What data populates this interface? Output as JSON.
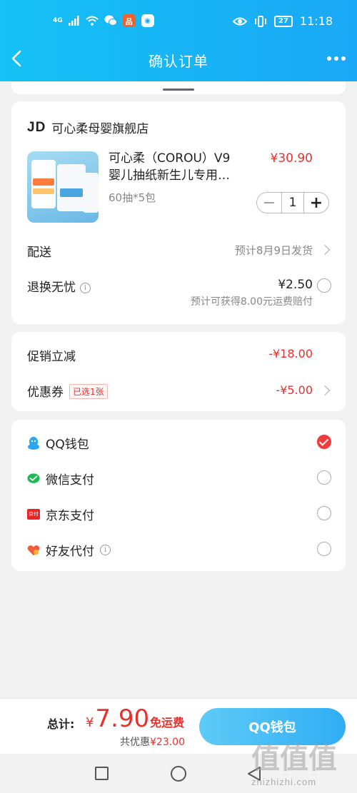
{
  "status_bar": {
    "network": "4G",
    "app_badge": "品",
    "battery": "27",
    "time": "11:18"
  },
  "nav": {
    "title": "确认订单"
  },
  "shop": {
    "logo": "JD",
    "name": "可心柔母婴旗舰店"
  },
  "product": {
    "title_line1": "可心柔（COROU）V9",
    "title_line2": "婴儿抽纸新生儿专用…",
    "price": "¥30.90",
    "spec": "60抽*5包",
    "quantity": "1",
    "minus": "−",
    "plus": "+"
  },
  "delivery": {
    "label": "配送",
    "value": "预计8月9日发货"
  },
  "return_insurance": {
    "label": "退换无忧",
    "info": "i",
    "price": "¥2.50",
    "note": "预计可获得8.00元运费赔付"
  },
  "promo": {
    "label": "促销立减",
    "value": "-¥18.00"
  },
  "coupon": {
    "label": "优惠券",
    "badge": "已选1张",
    "value": "-¥5.00"
  },
  "payment_methods": [
    {
      "label": "QQ钱包",
      "icon": "qq-penguin-icon",
      "selected": true
    },
    {
      "label": "微信支付",
      "icon": "wechat-icon",
      "selected": false
    },
    {
      "label": "京东支付",
      "icon": "jd-pay-icon",
      "selected": false
    },
    {
      "label": "好友代付",
      "icon": "heart-pay-icon",
      "selected": false,
      "info": "i"
    }
  ],
  "jd_pay_icon_text": "京付",
  "bottom": {
    "total_label": "总计:",
    "currency": "¥",
    "total": "7.90",
    "free_shipping": "免运费",
    "saving_label": "共优惠",
    "saving_value": "¥23.00",
    "pay_button": "QQ钱包"
  },
  "watermark": {
    "big": "值值值",
    "small": "zhizhizhi.com"
  },
  "colors": {
    "header": "#15c1f5",
    "accent_red": "#e9302d",
    "pay_button": "#30aef4"
  }
}
